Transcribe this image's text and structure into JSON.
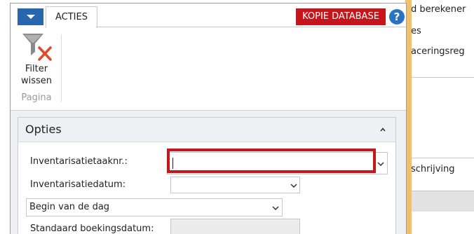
{
  "tabs": [
    {
      "label": "ACTIES"
    }
  ],
  "header": {
    "badge": "KOPIE DATABASE"
  },
  "ribbon": {
    "filter_button": {
      "line1": "Filter",
      "line2": "wissen"
    },
    "group_label": "Pagina"
  },
  "fasttab": {
    "title": "Opties"
  },
  "fields": {
    "inventarisatietaaknr": {
      "label": "Inventarisatietaaknr.:",
      "value": ""
    },
    "inventarisatiedatum": {
      "label": "Inventarisatiedatum:",
      "value": ""
    },
    "time_option": {
      "value": "Begin van de dag"
    },
    "standaard_boekingsdatum": {
      "label": "Standaard boekingsdatum:",
      "value": ""
    }
  },
  "background_window": {
    "lines": [
      "d berekener",
      "es",
      "aceringsreg",
      "schrijving"
    ]
  },
  "colors": {
    "accent": "#2866b0",
    "badge": "#c4161c",
    "highlight": "#c8161d",
    "strip": "#f2c06a"
  }
}
